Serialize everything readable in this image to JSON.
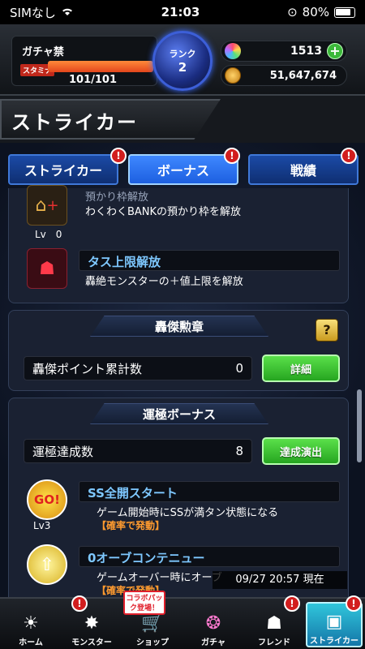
{
  "status_bar": {
    "carrier": "SIMなし",
    "time": "21:03",
    "battery": "80%"
  },
  "player": {
    "gacha_status": "ガチャ禁",
    "stamina_label": "スタミナ",
    "stamina": "101/101",
    "rank_label": "ランク",
    "rank": "2",
    "orbs": "1513",
    "gold": "51,647,674",
    "plus": "+"
  },
  "page_title": "ストライカー",
  "tabs": [
    {
      "label": "ストライカー",
      "badge": "!"
    },
    {
      "label": "ボーナス",
      "badge": "!"
    },
    {
      "label": "戦績",
      "badge": "!"
    }
  ],
  "upper_bonus": {
    "partial_title": "預かり枠解放",
    "item1_desc": "わくわくBANKの預かり枠を解放",
    "item1_level": "Lv　0",
    "item2_title": "タス上限解放",
    "item2_desc": "轟絶モンスターの＋値上限を解放"
  },
  "goketsu": {
    "header": "轟傑勲章",
    "help": "?",
    "points_label": "轟傑ポイント累計数",
    "points_value": "0",
    "detail_button": "詳細"
  },
  "unkyoku": {
    "header": "運極ボーナス",
    "count_label": "運極達成数",
    "count_value": "8",
    "action_button": "達成演出",
    "items": [
      {
        "icon_text": "GO!",
        "level": "Lv3",
        "title": "SS全開スタート",
        "desc": "ゲーム開始時にSSが満タン状態になる",
        "sub": "【確率で発動】"
      },
      {
        "icon_text": "",
        "level": "",
        "title": "0オーブコンテニュー",
        "desc": "ゲームオーバー時にオーブ",
        "sub": "【確率で発動】"
      }
    ]
  },
  "timestamp": "09/27 20:57 現在",
  "collab": "コラボパック登場！",
  "nav": [
    {
      "label": "ホーム",
      "icon": "home-icon",
      "glyph": "☀"
    },
    {
      "label": "モンスター",
      "icon": "monster-icon",
      "glyph": "✸"
    },
    {
      "label": "ショップ",
      "icon": "shop-icon",
      "glyph": "🛒"
    },
    {
      "label": "ガチャ",
      "icon": "gacha-icon",
      "glyph": "❂"
    },
    {
      "label": "フレンド",
      "icon": "friend-icon",
      "glyph": "☗"
    },
    {
      "label": "ストライカー",
      "icon": "striker-icon",
      "glyph": "▣"
    }
  ],
  "nav_badge": "!"
}
